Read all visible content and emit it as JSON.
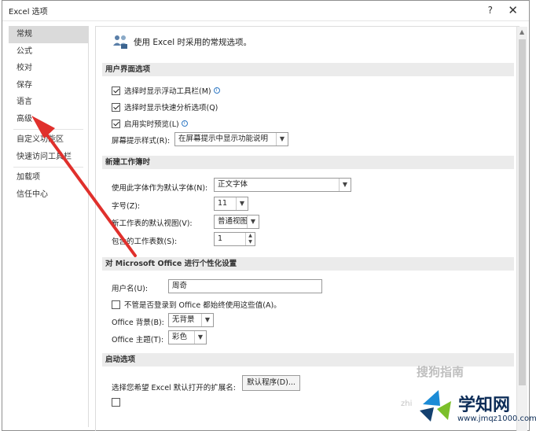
{
  "window": {
    "title": "Excel 选项",
    "help": "?",
    "close": "✕"
  },
  "nav": {
    "items": [
      {
        "label": "常规",
        "active": true
      },
      {
        "label": "公式",
        "active": false
      },
      {
        "label": "校对",
        "active": false
      },
      {
        "label": "保存",
        "active": false
      },
      {
        "label": "语言",
        "active": false
      },
      {
        "label": "高级",
        "active": false
      },
      {
        "label": "自定义功能区",
        "active": false
      },
      {
        "label": "快速访问工具栏",
        "active": false
      },
      {
        "label": "加载项",
        "active": false
      },
      {
        "label": "信任中心",
        "active": false
      }
    ]
  },
  "general": {
    "intro": "使用 Excel 时采用的常规选项。",
    "ui_section": "用户界面选项",
    "mini_toolbar": {
      "label": "选择时显示浮动工具栏(M)",
      "checked": true
    },
    "quick_analysis": {
      "label": "选择时显示快速分析选项(Q)",
      "checked": true
    },
    "live_preview": {
      "label": "启用实时预览(L)",
      "checked": true
    },
    "screentip_label": "屏幕提示样式(R):",
    "screentip_value": "在屏幕提示中显示功能说明",
    "workbook_section": "新建工作簿时",
    "font_label": "使用此字体作为默认字体(N):",
    "font_value": "正文字体",
    "size_label": "字号(Z):",
    "size_value": "11",
    "view_label": "新工作表的默认视图(V):",
    "view_value": "普通视图",
    "sheets_label": "包含的工作表数(S):",
    "sheets_value": "1",
    "personalize_section": "对 Microsoft Office 进行个性化设置",
    "username_label": "用户名(U):",
    "username_value": "周奇",
    "always_use": {
      "label": "不管是否登录到 Office 都始终使用这些值(A)。",
      "checked": false
    },
    "background_label": "Office 背景(B):",
    "background_value": "无背景",
    "theme_label": "Office 主题(T):",
    "theme_value": "彩色",
    "startup_section": "启动选项",
    "ext_label": "选择您希望 Excel 默认打开的扩展名:",
    "default_programs": "默认程序(D)..."
  },
  "watermarks": {
    "sogou": "搜狗指南",
    "site_name": "学知网",
    "site_url": "www.jmqz1000.com",
    "zhi": "zhi"
  },
  "colors": {
    "arrow": "#e0302c",
    "nav_active": "#dadada"
  }
}
